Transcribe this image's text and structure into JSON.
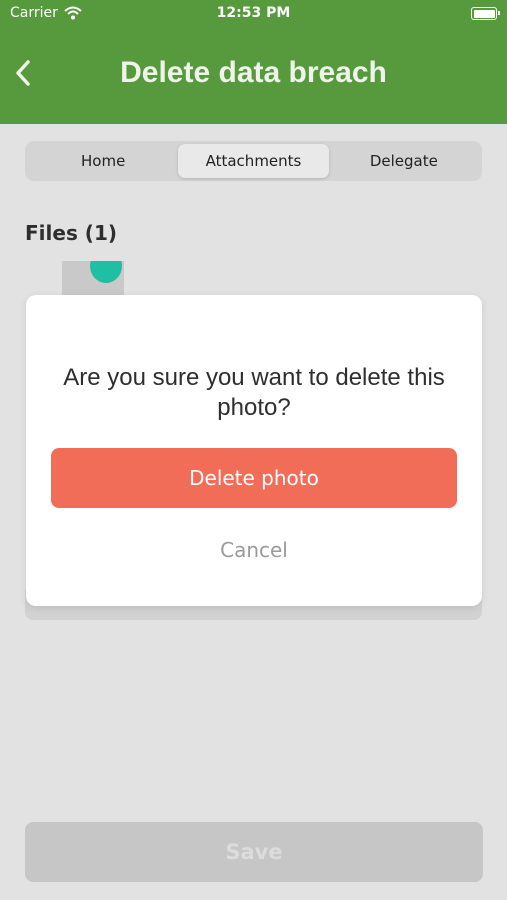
{
  "status_bar": {
    "carrier": "Carrier",
    "time": "12:53 PM"
  },
  "header": {
    "title": "Delete data breach"
  },
  "tabs": [
    {
      "label": "Home",
      "active": false
    },
    {
      "label": "Attachments",
      "active": true
    },
    {
      "label": "Delegate",
      "active": false
    }
  ],
  "files": {
    "label": "Files (1)"
  },
  "dialog": {
    "message": "Are you sure you want to delete this photo?",
    "confirm_label": "Delete photo",
    "cancel_label": "Cancel"
  },
  "footer": {
    "save_label": "Save"
  },
  "colors": {
    "header_green": "#579a3e",
    "destructive": "#f26d58",
    "accent_teal": "#1fbfa4"
  }
}
